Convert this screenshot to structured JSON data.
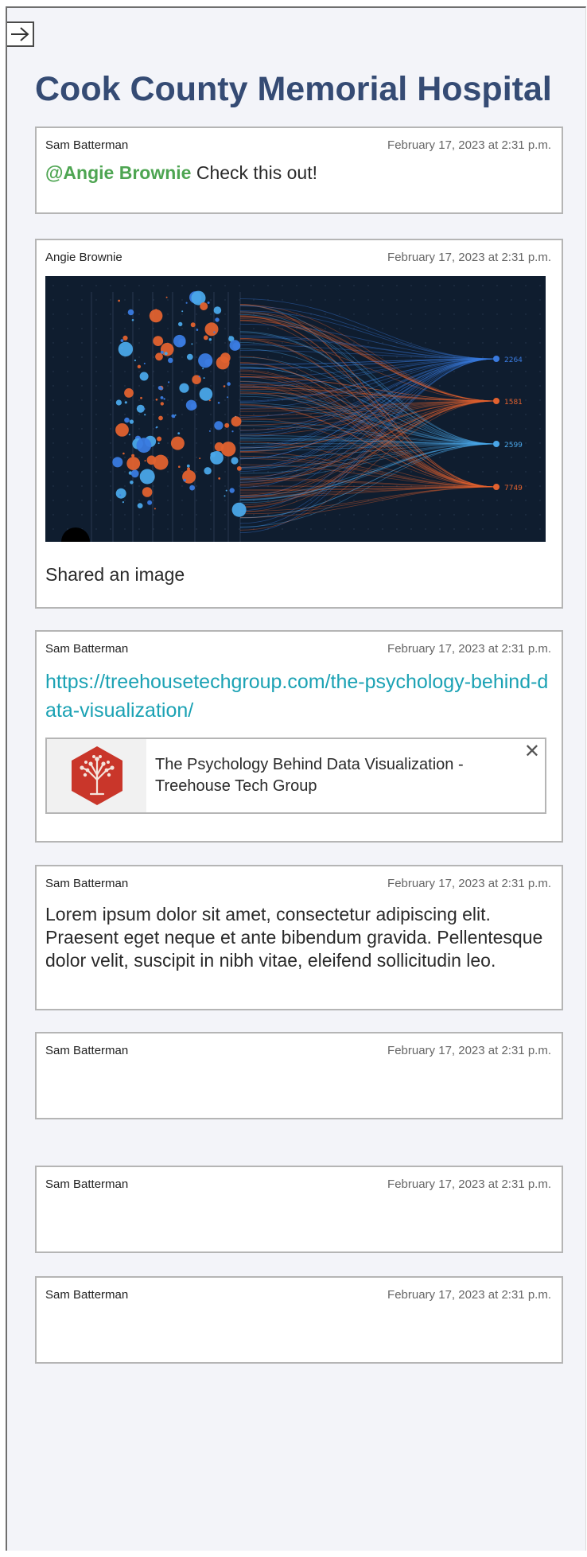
{
  "header": {
    "title": "Cook County Memorial Hospital",
    "collapse_icon": "arrow-right-icon"
  },
  "posts": [
    {
      "author": "Sam Batterman",
      "timestamp": "February 17, 2023 at 2:31 p.m.",
      "mention": "@Angie Brownie",
      "text": " Check this out!"
    },
    {
      "author": "Angie Brownie",
      "timestamp": "February 17, 2023 at 2:31 p.m.",
      "caption": "Shared an image",
      "image_labels": [
        "2264",
        "1581",
        "2599",
        "7749"
      ]
    },
    {
      "author": "Sam Batterman",
      "timestamp": "February 17, 2023 at 2:31 p.m.",
      "link": "https://treehousetechgroup.com/the-psychology-behind-data-visualization/",
      "preview_title": "The Psychology Behind Data Visualization - Treehouse Tech Group",
      "preview_close": "✕"
    },
    {
      "author": "Sam Batterman",
      "timestamp": "February 17, 2023 at 2:31 p.m.",
      "text": "Lorem ipsum dolor sit amet, consectetur adipiscing elit. Praesent eget neque et ante bibendum gravida. Pellentesque dolor velit, suscipit in nibh vitae, eleifend sollicitudin leo."
    },
    {
      "author": "Sam Batterman",
      "timestamp": "February 17, 2023 at 2:31 p.m."
    },
    {
      "author": "Sam Batterman",
      "timestamp": "February 17, 2023 at 2:31 p.m."
    },
    {
      "author": "Sam Batterman",
      "timestamp": "February 17, 2023 at 2:31 p.m."
    }
  ],
  "colors": {
    "title": "#354b74",
    "mention": "#4ea552",
    "link": "#1ba2b4",
    "background": "#f3f4f9",
    "card_border": "#b5b5b5",
    "viz_orange": "#e2622f",
    "viz_blue": "#3a7be0",
    "viz_light_blue": "#4aa6e8"
  }
}
